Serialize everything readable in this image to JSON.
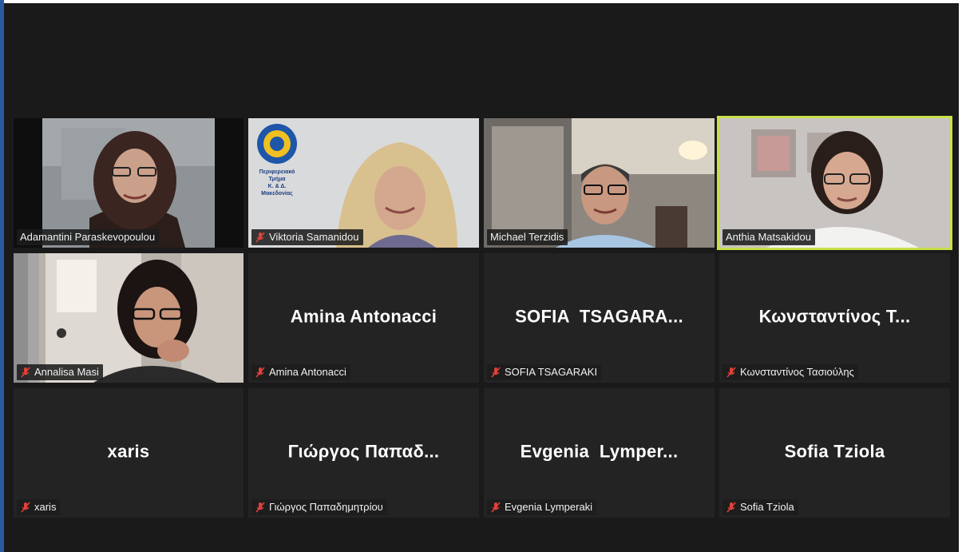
{
  "meeting": {
    "accent_border": "#c8e04a",
    "tile_bg": "#232323",
    "app_bg": "#1a1a1a"
  },
  "participants": [
    {
      "name": "Adamantini Paraskevopoulou",
      "muted": false,
      "video": true,
      "active": false
    },
    {
      "name": "Viktoria Samanidou",
      "muted": true,
      "video": true,
      "active": false,
      "logo_lines": [
        "Περιφερειακό Τμήμα",
        "Κ. & Δ.",
        "Μακεδονίας"
      ]
    },
    {
      "name": "Michael Terzidis",
      "muted": false,
      "video": true,
      "active": false
    },
    {
      "name": "Anthia Matsakidou",
      "muted": false,
      "video": true,
      "active": true
    },
    {
      "name": "Annalisa Masi",
      "muted": true,
      "video": true,
      "active": false
    },
    {
      "name": "Amina Antonacci",
      "display": "Amina Antonacci",
      "muted": true,
      "video": false
    },
    {
      "name": "SOFIA TSAGARAKI",
      "display": "SOFIA  TSAGARA...",
      "muted": true,
      "video": false
    },
    {
      "name": "Κωνσταντίνος Τασιούλης",
      "display": "Κωνσταντίνος Τ...",
      "muted": true,
      "video": false
    },
    {
      "name": "xaris",
      "display": "xaris",
      "muted": true,
      "video": false
    },
    {
      "name": "Γιώργος Παπαδημητρίου",
      "display": "Γιώργος Παπαδ...",
      "muted": true,
      "video": false
    },
    {
      "name": "Evgenia Lymperaki",
      "display": "Evgenia  Lymper...",
      "muted": true,
      "video": false
    },
    {
      "name": "Sofia Tziola",
      "display": "Sofia Tziola",
      "muted": true,
      "video": false
    }
  ]
}
